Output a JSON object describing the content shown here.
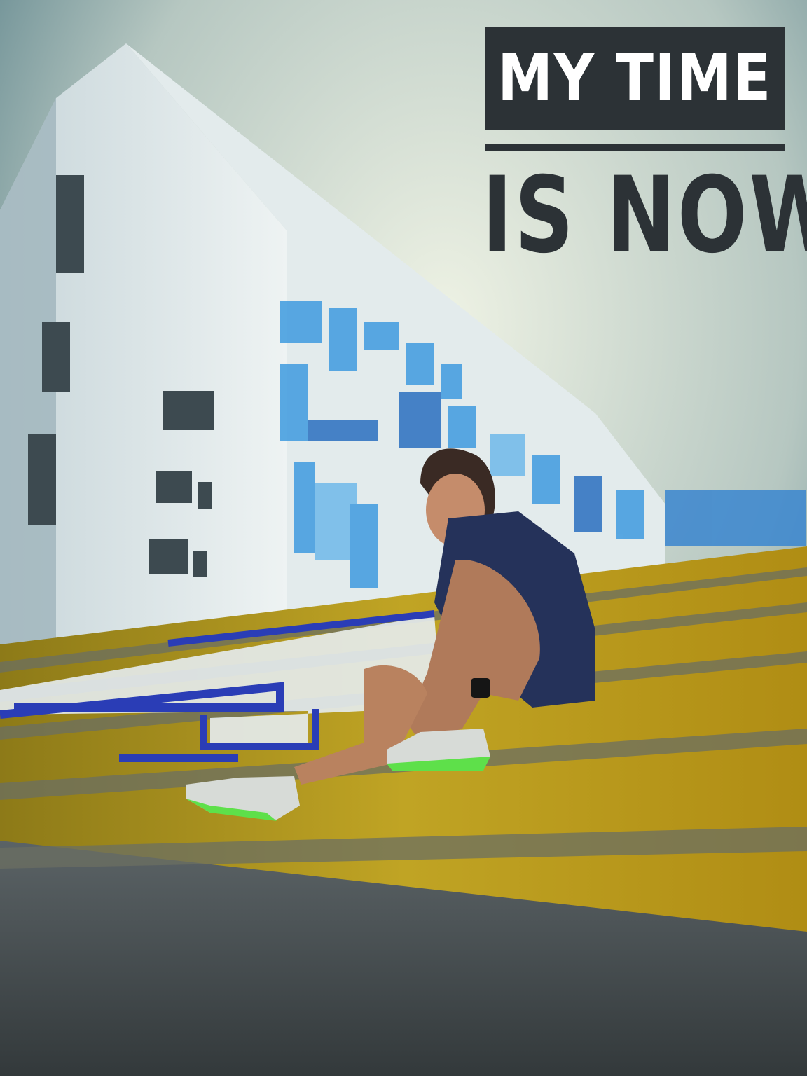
{
  "poster": {
    "headline_line1": "MY TIME",
    "headline_line2": "IS NOW."
  },
  "colors": {
    "sky": "#cfd8cf",
    "building": "#e8eeee",
    "tile_blue": "#2f8fd6",
    "steps_yellow": "#b59a1a",
    "title_box": "#2c3236"
  }
}
